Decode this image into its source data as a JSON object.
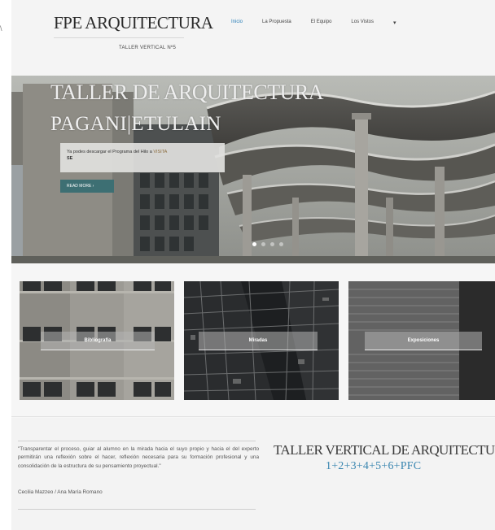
{
  "page_corner_mark": "\\",
  "header": {
    "logo": "FPE ARQUITECTURA",
    "tagline": "TALLER VERTICAL Nº5"
  },
  "nav": {
    "items": [
      {
        "label": "Inicio",
        "active": true
      },
      {
        "label": "La Propuesta",
        "active": false
      },
      {
        "label": "El Equipo",
        "active": false
      },
      {
        "label": "Los Vistos",
        "active": false
      }
    ],
    "extra": "▾"
  },
  "hero": {
    "title": "TALLER DE ARQUITECTURA",
    "subtitle": "PAGANI|ETULAIN",
    "box_text": "Ya podes descargar el Programa del Hilo",
    "box_text_cont": " a ",
    "box_highlight": "VISITA",
    "box_text_line2": "SE",
    "button_label": "READ MORE  ›",
    "slides": [
      true,
      false,
      false,
      false
    ]
  },
  "tiles": [
    {
      "label": "Bibliografía"
    },
    {
      "label": "Miradas"
    },
    {
      "label": "Exposiciones"
    }
  ],
  "footer": {
    "quote": "\"Transparentar el proceso, guiar al alumno en la mirada hacia el suyo propio y hacia el del experto permitirán una reflexión sobre el hacer, reflexión necesaria para su formación profesional y una consolidación de la estructura de su pensamiento proyectual.\"",
    "quote_author": "Cecilia Mazzeo / Ana María Romano",
    "title": "TALLER VERTICAL DE ARQUITECTURA",
    "subtitle": "1+2+3+4+5+6+PFC"
  },
  "colors": {
    "accent": "#2a7fb8",
    "button": "#3d6f73",
    "subtitle_blue": "#3a86b0"
  }
}
